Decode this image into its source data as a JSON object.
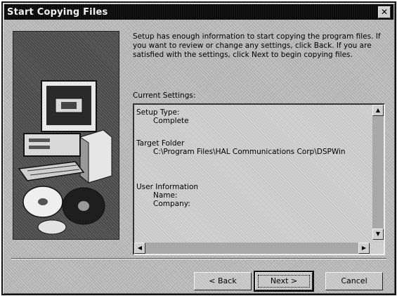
{
  "window": {
    "title": "Start Copying Files",
    "close_glyph": "✕"
  },
  "intro_text": "Setup has enough information to start copying the program files. If you want to review or change any settings, click Back.  If you are satisfied with the settings, click Next to begin copying files.",
  "settings": {
    "label": "Current Settings:",
    "setup_type_label": "Setup Type:",
    "setup_type_value": "Complete",
    "target_folder_label": "Target Folder",
    "target_folder_value": "C:\\Program Files\\HAL Communications Corp\\DSPWin",
    "user_info_label": "User Information",
    "name_label": "Name:",
    "company_label": "Company:"
  },
  "scroll_glyphs": {
    "up": "▲",
    "down": "▼",
    "left": "◀",
    "right": "▶"
  },
  "buttons": {
    "back": "< Back",
    "next": "Next >",
    "cancel": "Cancel"
  },
  "icons": [
    "computer-icon",
    "cd-disc-icon",
    "close-icon"
  ]
}
